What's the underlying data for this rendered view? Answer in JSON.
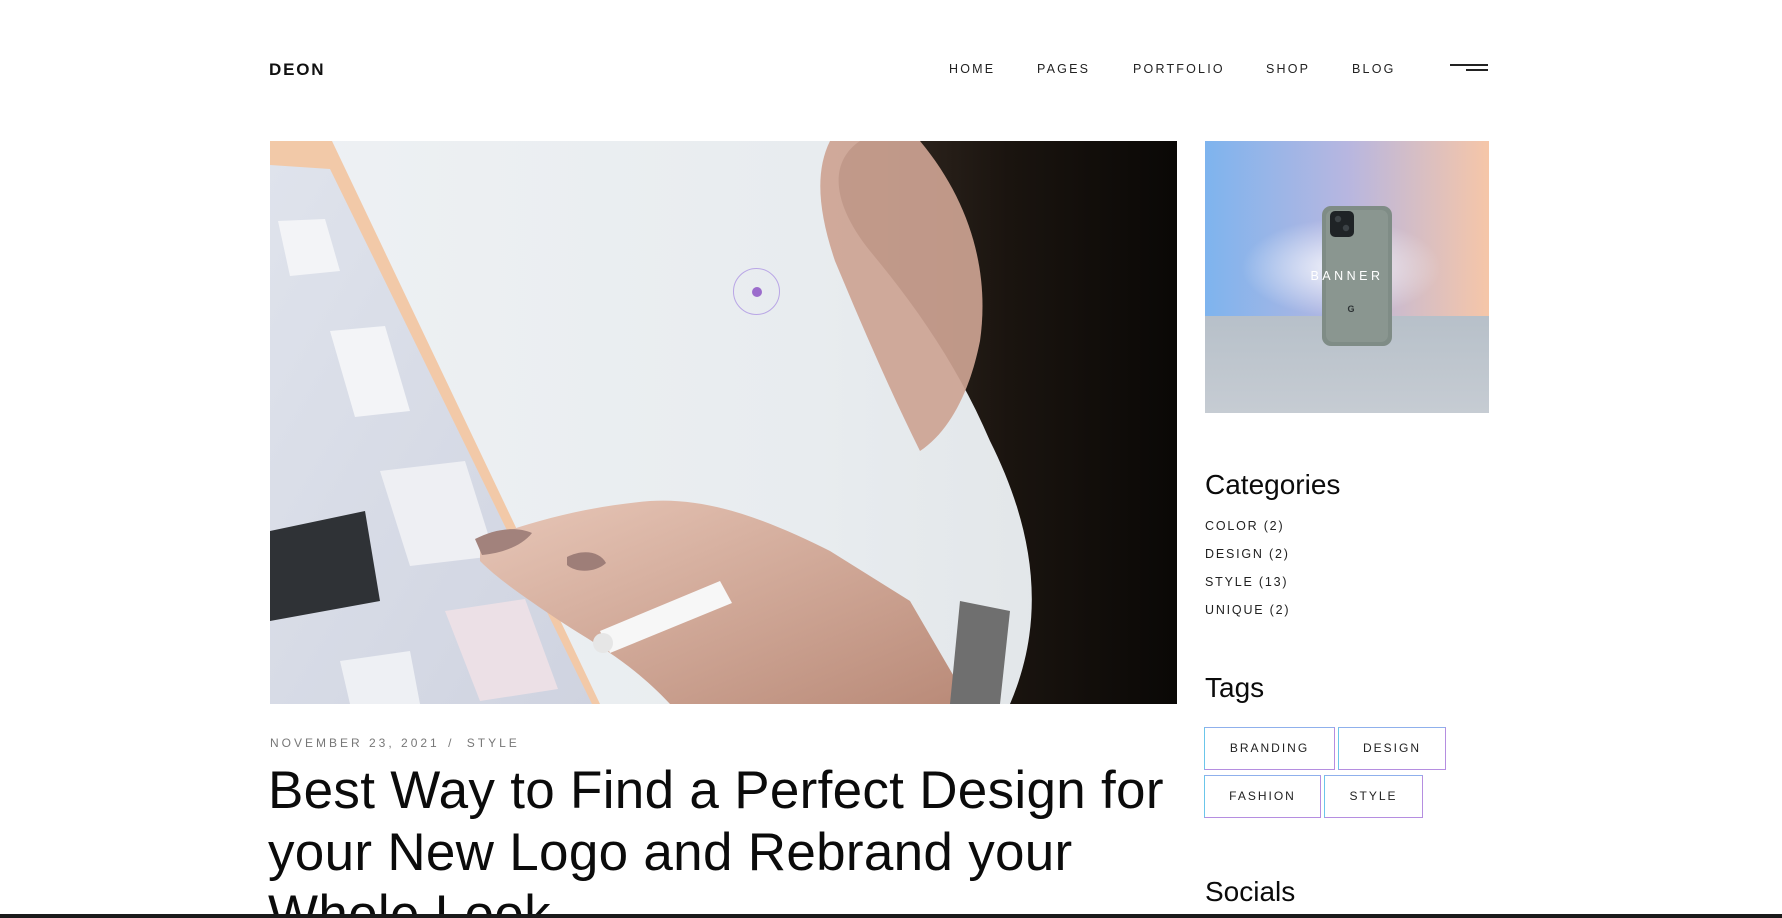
{
  "header": {
    "logo": "DEON",
    "nav": [
      {
        "label": "HOME"
      },
      {
        "label": "PAGES"
      },
      {
        "label": "PORTFOLIO"
      },
      {
        "label": "SHOP"
      },
      {
        "label": "BLOG"
      }
    ],
    "menu_icon": "hamburger-menu-icon"
  },
  "post": {
    "date": "NOVEMBER 23, 2021",
    "separator": "/",
    "category": "STYLE",
    "title": "Best Way to Find a Perfect Design for your New Logo and Rebrand your Whole Look"
  },
  "sidebar": {
    "banner_label": "BANNER",
    "categories_title": "Categories",
    "categories": [
      {
        "label": "COLOR (2)"
      },
      {
        "label": "DESIGN (2)"
      },
      {
        "label": "STYLE (13)"
      },
      {
        "label": "UNIQUE (2)"
      }
    ],
    "tags_title": "Tags",
    "tags": [
      {
        "label": "BRANDING"
      },
      {
        "label": "DESIGN"
      },
      {
        "label": "FASHION"
      },
      {
        "label": "STYLE"
      }
    ],
    "socials_title": "Socials"
  },
  "colors": {
    "text": "#111111",
    "accent_purple": "#9b6ccc",
    "tag_border_gradient_start": "#6bc6ea",
    "tag_border_gradient_end": "#b58ee0"
  }
}
